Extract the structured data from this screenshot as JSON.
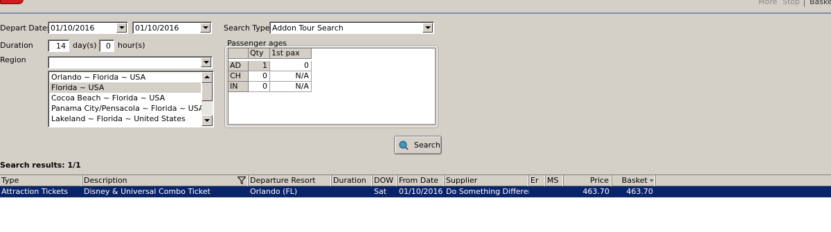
{
  "top_bar": {
    "links": [
      "More",
      "Stop",
      "Basket"
    ]
  },
  "form": {
    "depart_dates_label": "Depart Dates",
    "depart_date_from": "01/10/2016",
    "depart_date_to": "01/10/2016",
    "search_type_label": "Search Type",
    "search_type_value": "Addon Tour Search",
    "duration_label": "Duration",
    "duration_days": "14",
    "days_unit": "day(s)",
    "duration_hours": "0",
    "hours_unit": "hour(s)",
    "region_label": "Region",
    "region_value": "",
    "region_options": [
      "Orlando ~ Florida ~ USA",
      "Florida ~ USA",
      "Cocoa Beach ~ Florida ~ USA",
      "Panama City/Pensacola ~  Florida  ~ USA",
      "Lakeland ~ Florida ~ United States"
    ],
    "region_selected_index": 1
  },
  "passengers": {
    "group_label": "Passenger ages",
    "columns": [
      "Qty",
      "1st pax"
    ],
    "rows": [
      {
        "type": "AD",
        "qty": "1",
        "first_pax": "0"
      },
      {
        "type": "CH",
        "qty": "0",
        "first_pax": "N/A"
      },
      {
        "type": "IN",
        "qty": "0",
        "first_pax": "N/A"
      }
    ]
  },
  "search_button": {
    "label": "Search",
    "icon": "search-globe-icon"
  },
  "results": {
    "summary": "Search results: 1/1",
    "columns": [
      "Type",
      "Description",
      "Departure Resort",
      "Duration",
      "DOW",
      "From Date",
      "Supplier",
      "Er",
      "MS",
      "Price",
      "Basket"
    ],
    "rows": [
      {
        "type": "Attraction Tickets",
        "description": "Disney & Universal Combo Ticket",
        "departure_resort": "Orlando (FL)",
        "duration": "",
        "dow": "Sat",
        "from_date": "01/10/2016",
        "supplier": "Do Something Different",
        "er": "",
        "ms": "",
        "price": "463.70",
        "basket": "463.70"
      }
    ]
  },
  "colors": {
    "window_bg": "#d4d0c8",
    "selection_bg": "#0a246a",
    "selection_fg": "#ffffff",
    "top_border": "#7e8cae"
  }
}
